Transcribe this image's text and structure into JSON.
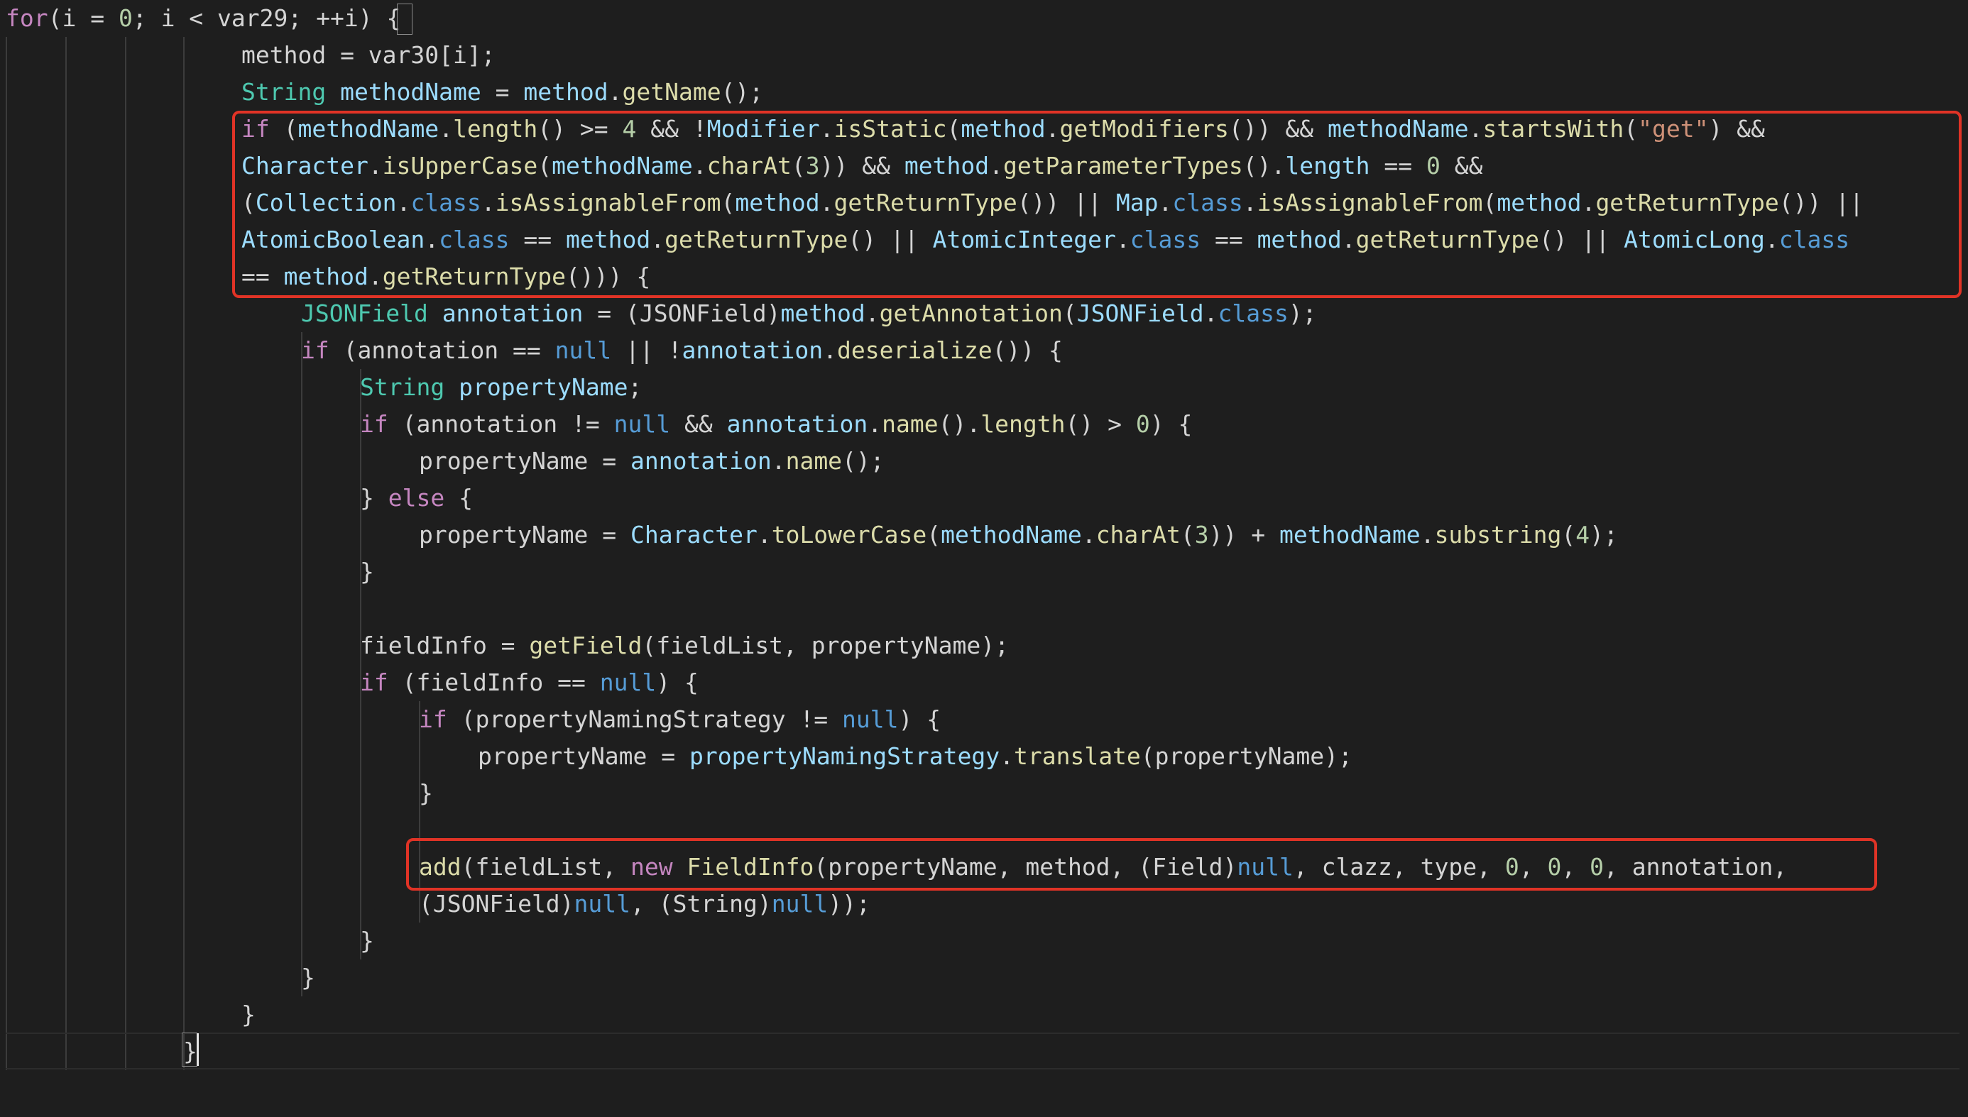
{
  "editor": {
    "theme": "dark",
    "colors": {
      "background": "#1e1e1e",
      "keyword": "#c586c0",
      "type": "#4ec9b0",
      "variable": "#9cdcfe",
      "function": "#dcdcaa",
      "number": "#b5cea8",
      "string": "#ce9178",
      "plain": "#d4d4d4",
      "literal": "#569cd6",
      "highlight_border": "#e03326"
    },
    "lines": [
      {
        "indent": 0,
        "tokens": [
          [
            "for",
            "kw"
          ],
          [
            "(i = ",
            "p"
          ],
          [
            "0",
            "num"
          ],
          [
            "; i < var29; ++i) ",
            "p"
          ],
          [
            "{",
            "p"
          ]
        ]
      },
      {
        "indent": 4,
        "tokens": [
          [
            "method = var30[i];",
            "p"
          ]
        ]
      },
      {
        "indent": 4,
        "tokens": [
          [
            "String",
            "ty"
          ],
          [
            " ",
            "p"
          ],
          [
            "methodName",
            "var"
          ],
          [
            " = ",
            "p"
          ],
          [
            "method",
            "var"
          ],
          [
            ".",
            "p"
          ],
          [
            "getName",
            "fn"
          ],
          [
            "();",
            "p"
          ]
        ]
      },
      {
        "indent": 4,
        "tokens": [
          [
            "if",
            "kw"
          ],
          [
            " (",
            "p"
          ],
          [
            "methodName",
            "var"
          ],
          [
            ".",
            "p"
          ],
          [
            "length",
            "fn"
          ],
          [
            "() >= ",
            "p"
          ],
          [
            "4",
            "num"
          ],
          [
            " && !",
            "p"
          ],
          [
            "Modifier",
            "var"
          ],
          [
            ".",
            "p"
          ],
          [
            "isStatic",
            "fn"
          ],
          [
            "(",
            "p"
          ],
          [
            "method",
            "var"
          ],
          [
            ".",
            "p"
          ],
          [
            "getModifiers",
            "fn"
          ],
          [
            "()) && ",
            "p"
          ],
          [
            "methodName",
            "var"
          ],
          [
            ".",
            "p"
          ],
          [
            "startsWith",
            "fn"
          ],
          [
            "(",
            "p"
          ],
          [
            "\"get\"",
            "str"
          ],
          [
            ") &&",
            "p"
          ]
        ]
      },
      {
        "indent": 4,
        "tokens": [
          [
            "Character",
            "var"
          ],
          [
            ".",
            "p"
          ],
          [
            "isUpperCase",
            "fn"
          ],
          [
            "(",
            "p"
          ],
          [
            "methodName",
            "var"
          ],
          [
            ".",
            "p"
          ],
          [
            "charAt",
            "fn"
          ],
          [
            "(",
            "p"
          ],
          [
            "3",
            "num"
          ],
          [
            ")) && ",
            "p"
          ],
          [
            "method",
            "var"
          ],
          [
            ".",
            "p"
          ],
          [
            "getParameterTypes",
            "fn"
          ],
          [
            "().",
            "p"
          ],
          [
            "length",
            "var"
          ],
          [
            " == ",
            "p"
          ],
          [
            "0",
            "num"
          ],
          [
            " &&",
            "p"
          ]
        ]
      },
      {
        "indent": 4,
        "tokens": [
          [
            "(",
            "p"
          ],
          [
            "Collection",
            "var"
          ],
          [
            ".",
            "p"
          ],
          [
            "class",
            "lit"
          ],
          [
            ".",
            "p"
          ],
          [
            "isAssignableFrom",
            "fn"
          ],
          [
            "(",
            "p"
          ],
          [
            "method",
            "var"
          ],
          [
            ".",
            "p"
          ],
          [
            "getReturnType",
            "fn"
          ],
          [
            "()) || ",
            "p"
          ],
          [
            "Map",
            "var"
          ],
          [
            ".",
            "p"
          ],
          [
            "class",
            "lit"
          ],
          [
            ".",
            "p"
          ],
          [
            "isAssignableFrom",
            "fn"
          ],
          [
            "(",
            "p"
          ],
          [
            "method",
            "var"
          ],
          [
            ".",
            "p"
          ],
          [
            "getReturnType",
            "fn"
          ],
          [
            "()) ||",
            "p"
          ]
        ]
      },
      {
        "indent": 4,
        "tokens": [
          [
            "AtomicBoolean",
            "var"
          ],
          [
            ".",
            "p"
          ],
          [
            "class",
            "lit"
          ],
          [
            " == ",
            "p"
          ],
          [
            "method",
            "var"
          ],
          [
            ".",
            "p"
          ],
          [
            "getReturnType",
            "fn"
          ],
          [
            "() || ",
            "p"
          ],
          [
            "AtomicInteger",
            "var"
          ],
          [
            ".",
            "p"
          ],
          [
            "class",
            "lit"
          ],
          [
            " == ",
            "p"
          ],
          [
            "method",
            "var"
          ],
          [
            ".",
            "p"
          ],
          [
            "getReturnType",
            "fn"
          ],
          [
            "() || ",
            "p"
          ],
          [
            "AtomicLong",
            "var"
          ],
          [
            ".",
            "p"
          ],
          [
            "class",
            "lit"
          ]
        ]
      },
      {
        "indent": 4,
        "tokens": [
          [
            "== ",
            "p"
          ],
          [
            "method",
            "var"
          ],
          [
            ".",
            "p"
          ],
          [
            "getReturnType",
            "fn"
          ],
          [
            "())) {",
            "p"
          ]
        ]
      },
      {
        "indent": 5,
        "tokens": [
          [
            "JSONField",
            "ty"
          ],
          [
            " ",
            "p"
          ],
          [
            "annotation",
            "var"
          ],
          [
            " = (JSONField)",
            "p"
          ],
          [
            "method",
            "var"
          ],
          [
            ".",
            "p"
          ],
          [
            "getAnnotation",
            "fn"
          ],
          [
            "(",
            "p"
          ],
          [
            "JSONField",
            "var"
          ],
          [
            ".",
            "p"
          ],
          [
            "class",
            "lit"
          ],
          [
            ");",
            "p"
          ]
        ]
      },
      {
        "indent": 5,
        "tokens": [
          [
            "if",
            "kw"
          ],
          [
            " (annotation == ",
            "p"
          ],
          [
            "null",
            "lit"
          ],
          [
            " || !",
            "p"
          ],
          [
            "annotation",
            "var"
          ],
          [
            ".",
            "p"
          ],
          [
            "deserialize",
            "fn"
          ],
          [
            "()) {",
            "p"
          ]
        ]
      },
      {
        "indent": 6,
        "tokens": [
          [
            "String",
            "ty"
          ],
          [
            " ",
            "p"
          ],
          [
            "propertyName",
            "var"
          ],
          [
            ";",
            "p"
          ]
        ]
      },
      {
        "indent": 6,
        "tokens": [
          [
            "if",
            "kw"
          ],
          [
            " (annotation != ",
            "p"
          ],
          [
            "null",
            "lit"
          ],
          [
            " && ",
            "p"
          ],
          [
            "annotation",
            "var"
          ],
          [
            ".",
            "p"
          ],
          [
            "name",
            "fn"
          ],
          [
            "().",
            "p"
          ],
          [
            "length",
            "fn"
          ],
          [
            "() > ",
            "p"
          ],
          [
            "0",
            "num"
          ],
          [
            ") {",
            "p"
          ]
        ]
      },
      {
        "indent": 7,
        "tokens": [
          [
            "propertyName = ",
            "p"
          ],
          [
            "annotation",
            "var"
          ],
          [
            ".",
            "p"
          ],
          [
            "name",
            "fn"
          ],
          [
            "();",
            "p"
          ]
        ]
      },
      {
        "indent": 6,
        "tokens": [
          [
            "} ",
            "p"
          ],
          [
            "else",
            "kw"
          ],
          [
            " {",
            "p"
          ]
        ]
      },
      {
        "indent": 7,
        "tokens": [
          [
            "propertyName = ",
            "p"
          ],
          [
            "Character",
            "var"
          ],
          [
            ".",
            "p"
          ],
          [
            "toLowerCase",
            "fn"
          ],
          [
            "(",
            "p"
          ],
          [
            "methodName",
            "var"
          ],
          [
            ".",
            "p"
          ],
          [
            "charAt",
            "fn"
          ],
          [
            "(",
            "p"
          ],
          [
            "3",
            "num"
          ],
          [
            ")) + ",
            "p"
          ],
          [
            "methodName",
            "var"
          ],
          [
            ".",
            "p"
          ],
          [
            "substring",
            "fn"
          ],
          [
            "(",
            "p"
          ],
          [
            "4",
            "num"
          ],
          [
            ");",
            "p"
          ]
        ]
      },
      {
        "indent": 6,
        "tokens": [
          [
            "}",
            "p"
          ]
        ]
      },
      {
        "indent": 0,
        "tokens": []
      },
      {
        "indent": 6,
        "tokens": [
          [
            "fieldInfo = ",
            "p"
          ],
          [
            "getField",
            "fn"
          ],
          [
            "(fieldList, propertyName);",
            "p"
          ]
        ]
      },
      {
        "indent": 6,
        "tokens": [
          [
            "if",
            "kw"
          ],
          [
            " (fieldInfo == ",
            "p"
          ],
          [
            "null",
            "lit"
          ],
          [
            ") {",
            "p"
          ]
        ]
      },
      {
        "indent": 7,
        "tokens": [
          [
            "if",
            "kw"
          ],
          [
            " (propertyNamingStrategy != ",
            "p"
          ],
          [
            "null",
            "lit"
          ],
          [
            ") {",
            "p"
          ]
        ]
      },
      {
        "indent": 8,
        "tokens": [
          [
            "propertyName = ",
            "p"
          ],
          [
            "propertyNamingStrategy",
            "var"
          ],
          [
            ".",
            "p"
          ],
          [
            "translate",
            "fn"
          ],
          [
            "(propertyName);",
            "p"
          ]
        ]
      },
      {
        "indent": 7,
        "tokens": [
          [
            "}",
            "p"
          ]
        ]
      },
      {
        "indent": 0,
        "tokens": []
      },
      {
        "indent": 7,
        "tokens": [
          [
            "add",
            "fn"
          ],
          [
            "(fieldList, ",
            "p"
          ],
          [
            "new",
            "kw"
          ],
          [
            " ",
            "p"
          ],
          [
            "FieldInfo",
            "fn"
          ],
          [
            "(propertyName, method, (Field)",
            "p"
          ],
          [
            "null",
            "lit"
          ],
          [
            ", clazz, type, ",
            "p"
          ],
          [
            "0",
            "num"
          ],
          [
            ", ",
            "p"
          ],
          [
            "0",
            "num"
          ],
          [
            ", ",
            "p"
          ],
          [
            "0",
            "num"
          ],
          [
            ", annotation,",
            "p"
          ]
        ]
      },
      {
        "indent": 7,
        "tokens": [
          [
            "(JSONField)",
            "p"
          ],
          [
            "null",
            "lit"
          ],
          [
            ", (String)",
            "p"
          ],
          [
            "null",
            "lit"
          ],
          [
            "));",
            "p"
          ]
        ]
      },
      {
        "indent": 6,
        "tokens": [
          [
            "}",
            "p"
          ]
        ]
      },
      {
        "indent": 5,
        "tokens": [
          [
            "}",
            "p"
          ]
        ]
      },
      {
        "indent": 4,
        "tokens": [
          [
            "}",
            "p"
          ]
        ]
      },
      {
        "indent": 3,
        "tokens": [
          [
            "}",
            "p"
          ]
        ]
      }
    ]
  }
}
